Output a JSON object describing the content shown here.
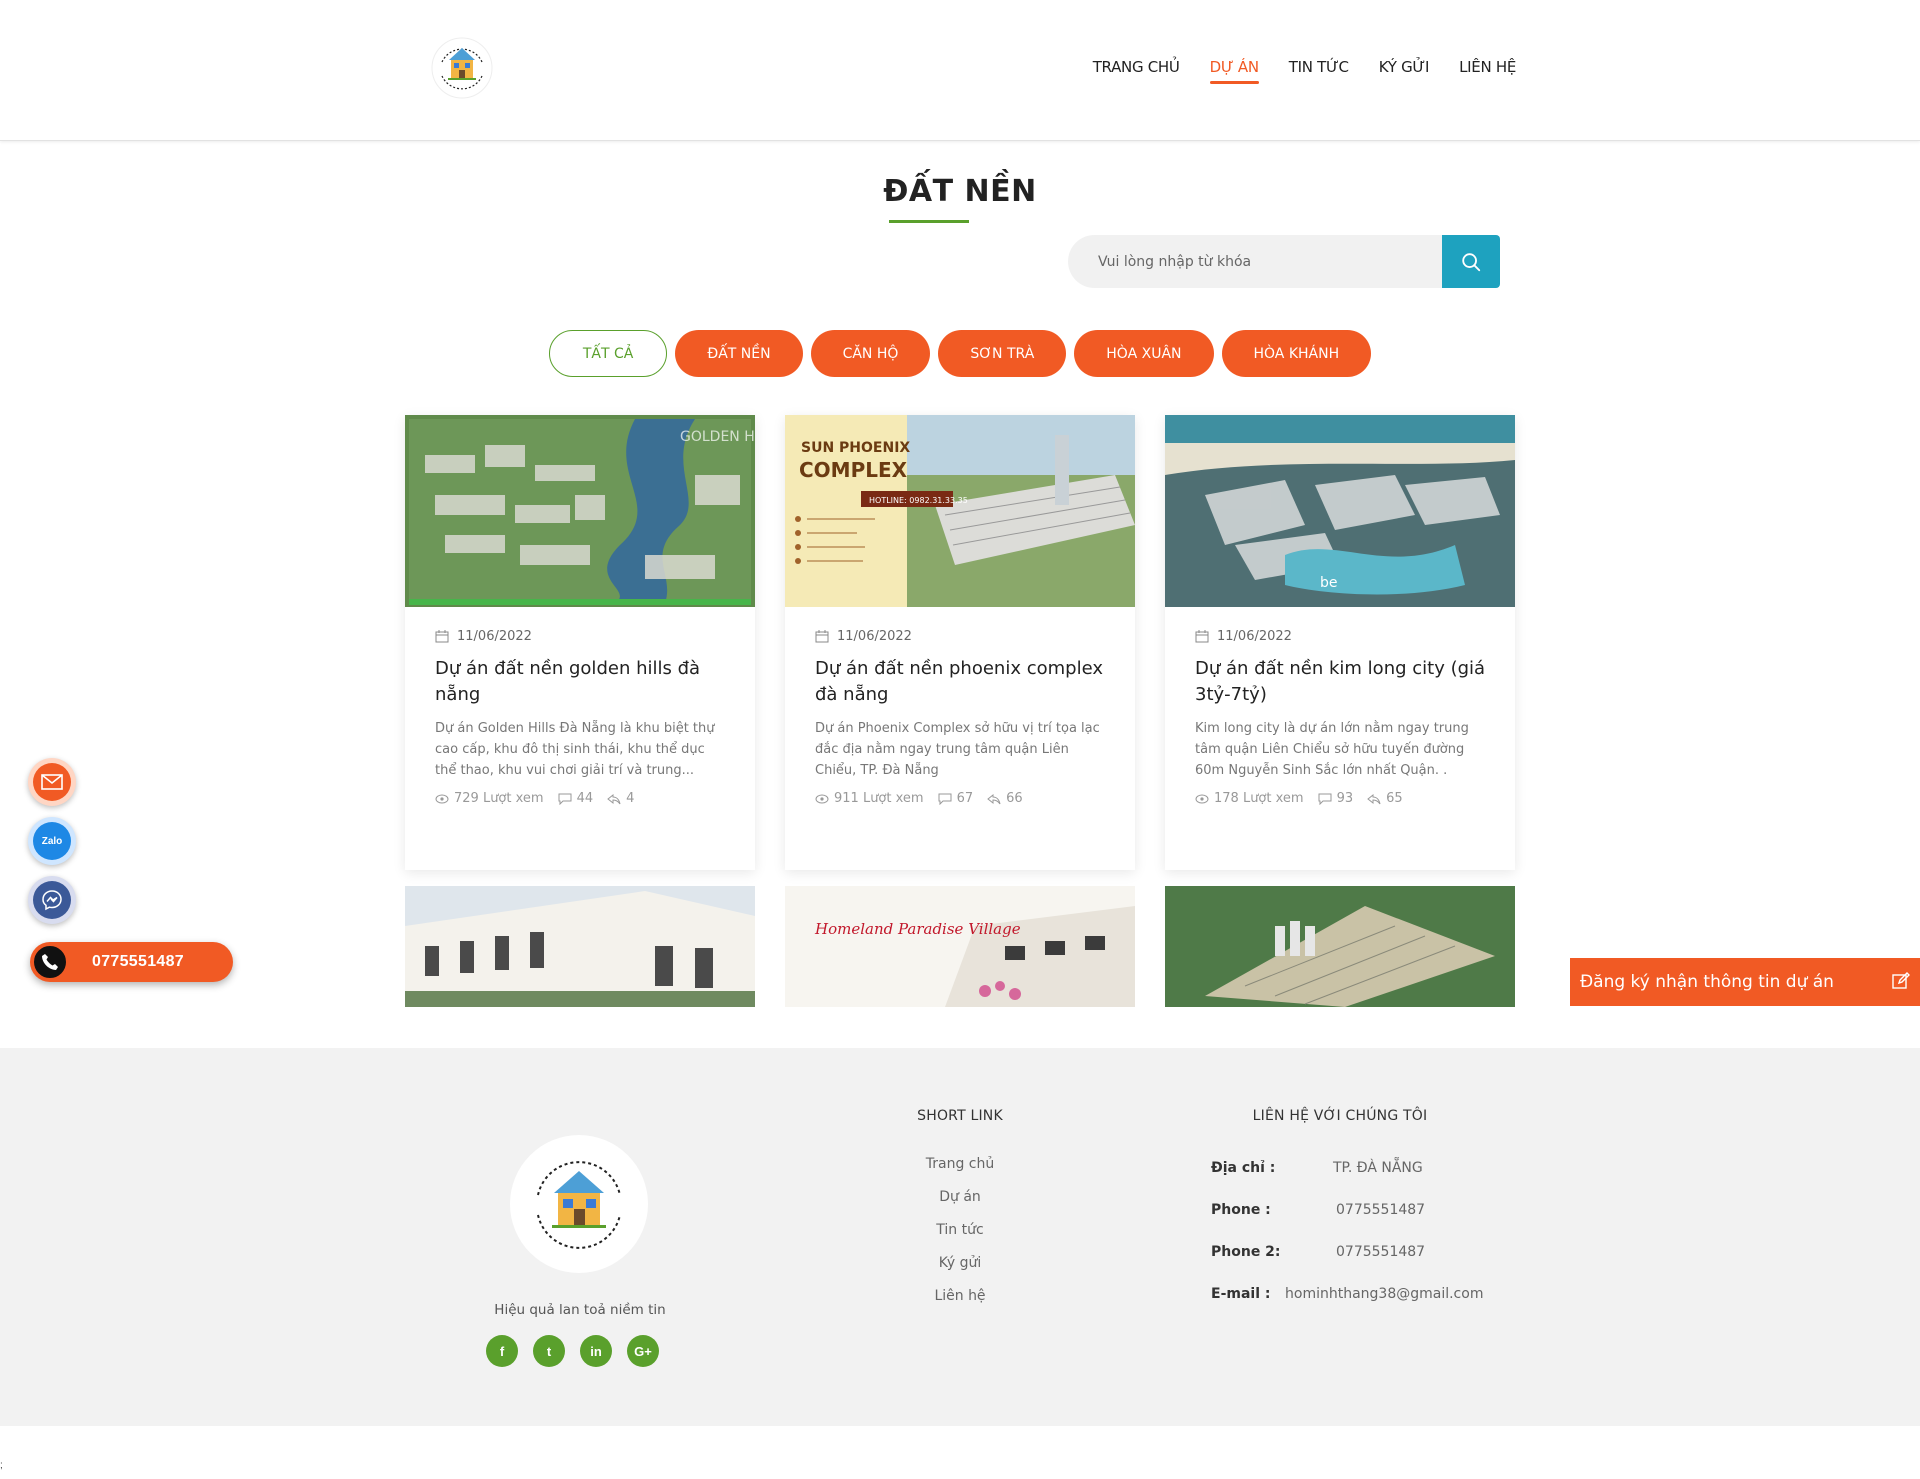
{
  "header": {
    "nav": [
      {
        "label": "TRANG CHỦ",
        "active": false
      },
      {
        "label": "DỰ ÁN",
        "active": true
      },
      {
        "label": "TIN TỨC",
        "active": false
      },
      {
        "label": "KÝ GỬI",
        "active": false
      },
      {
        "label": "LIÊN HỆ",
        "active": false
      }
    ]
  },
  "page_title": "ĐẤT NỀN",
  "search": {
    "placeholder": "Vui lòng nhập từ khóa"
  },
  "filters": [
    "TẤT CẢ",
    "ĐẤT NỀN",
    "CĂN HỘ",
    "SƠN TRÀ",
    "HÒA XUÂN",
    "HÒA KHÁNH"
  ],
  "cards": [
    {
      "date": "11/06/2022",
      "title": "Dự án đất nền golden hills đà nẵng",
      "desc": "Dự án Golden Hills Đà Nẵng là khu biệt thự cao cấp, khu đô thị sinh thái, khu thể dục thể thao, khu vui chơi giải trí và trung...",
      "views": "729 Lượt xem",
      "comments": "44",
      "shares": "4",
      "image_label": "GOLDEN HILLS"
    },
    {
      "date": "11/06/2022",
      "title": "Dự án đất nền phoenix complex đà nẵng",
      "desc": "Dự án Phoenix Complex sở hữu vị trí tọa lạc đắc địa nằm ngay trung tâm quận Liên Chiểu, TP. Đà Nẵng",
      "views": "911 Lượt xem",
      "comments": "67",
      "shares": "66",
      "image_label_1": "SUN PHOENIX",
      "image_label_2": "COMPLEX",
      "image_hotline": "HOTLINE: 0982.31.33.35"
    },
    {
      "date": "11/06/2022",
      "title": "Dự án đất nền kim long city (giá 3tỷ-7tỷ)",
      "desc": "Kim long city là dự án lớn nằm ngay trung tâm quận Liên Chiểu sở hữu tuyến đường 60m Nguyễn Sinh Sắc lớn nhất Quận. .",
      "views": "178 Lượt xem",
      "comments": "93",
      "shares": "65"
    }
  ],
  "row2_labels": {
    "homeland": "Homeland Paradise Village"
  },
  "float": {
    "phone": "0775551487",
    "zalo": "Zalo"
  },
  "register_bar": "Đăng ký nhận thông tin dự án",
  "footer": {
    "slogan": "Hiệu quả lan toả niềm tin",
    "short_link_heading": "SHORT LINK",
    "links": [
      "Trang chủ",
      "Dự án",
      "Tin tức",
      "Ký gửi",
      "Liên hệ"
    ],
    "contact_heading": "LIÊN HỆ VỚI CHÚNG TÔI",
    "contact": [
      {
        "label": "Địa chỉ :",
        "value": "TP. ĐÀ NẴNG"
      },
      {
        "label": "Phone :",
        "value": "0775551487"
      },
      {
        "label": "Phone 2:",
        "value": "0775551487"
      },
      {
        "label": "E-mail :",
        "value": "hominhthang38@gmail.com"
      }
    ],
    "socials": [
      "f",
      "t",
      "in",
      "G+"
    ]
  },
  "colors": {
    "accent": "#f15a24",
    "green": "#5aa02c",
    "teal": "#1ea2bf"
  },
  "bottom_mark": ";"
}
